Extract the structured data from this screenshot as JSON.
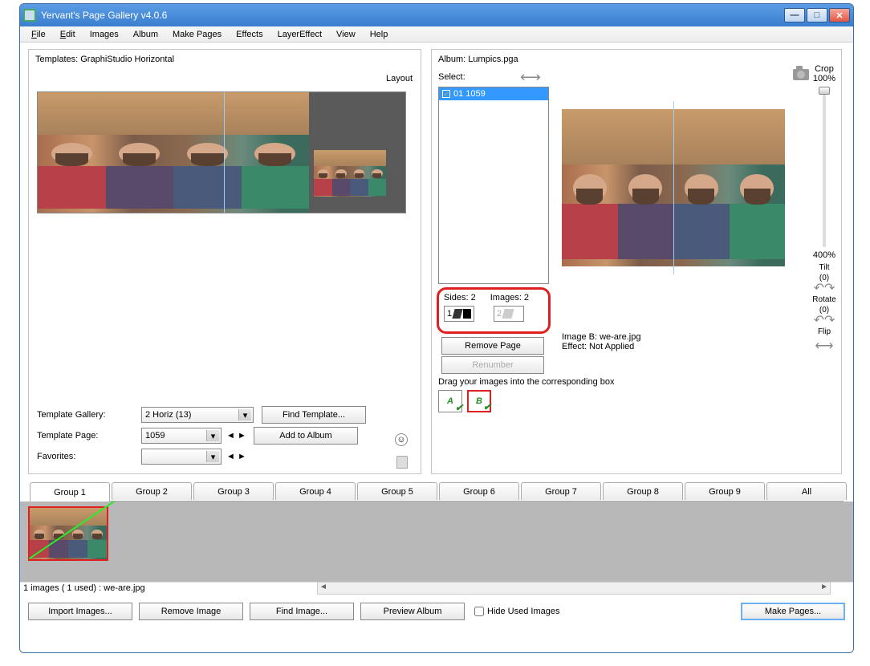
{
  "window": {
    "title": "Yervant's Page Gallery v4.0.6"
  },
  "menu": [
    "File",
    "Edit",
    "Images",
    "Album",
    "Make Pages",
    "Effects",
    "LayerEffect",
    "View",
    "Help"
  ],
  "templates": {
    "header_prefix": "Templates:  ",
    "header_value": "GraphiStudio Horizontal",
    "layout_label": "Layout",
    "gallery_label": "Template Gallery:",
    "gallery_value": "2 Horiz (13)",
    "find_template_btn": "Find Template...",
    "page_label": "Template Page:",
    "page_value": "1059",
    "add_to_album_btn": "Add to Album",
    "favorites_label": "Favorites:",
    "favorites_value": ""
  },
  "album": {
    "header_prefix": "Album:  ",
    "header_value": "Lumpics.pga",
    "select_label": "Select:",
    "list_item": "01  1059",
    "sides_label": "Sides: 2",
    "images_label": "Images: 2",
    "cell_left": "1",
    "cell_right": "2",
    "remove_page_btn": "Remove Page",
    "renumber_btn": "Renumber",
    "image_info_name": "Image B: we-are.jpg",
    "image_info_effect": "Effect: Not Applied",
    "drag_text": "Drag your images into the corresponding box",
    "box_a": "A",
    "box_b": "B"
  },
  "side": {
    "crop_label": "Crop",
    "crop_top": "100%",
    "crop_bottom": "400%",
    "tilt_label": "Tilt",
    "tilt_val": "(0)",
    "rotate_label": "Rotate",
    "rotate_val": "(0)",
    "flip_label": "Flip"
  },
  "groups": [
    "Group 1",
    "Group 2",
    "Group 3",
    "Group 4",
    "Group 5",
    "Group 6",
    "Group 7",
    "Group 8",
    "Group 9",
    "All"
  ],
  "status_text": "1 images ( 1 used) : we-are.jpg",
  "bottom": {
    "import": "Import Images...",
    "remove": "Remove Image",
    "find": "Find Image...",
    "preview": "Preview Album",
    "hide_chk": "Hide Used Images",
    "make": "Make Pages..."
  }
}
